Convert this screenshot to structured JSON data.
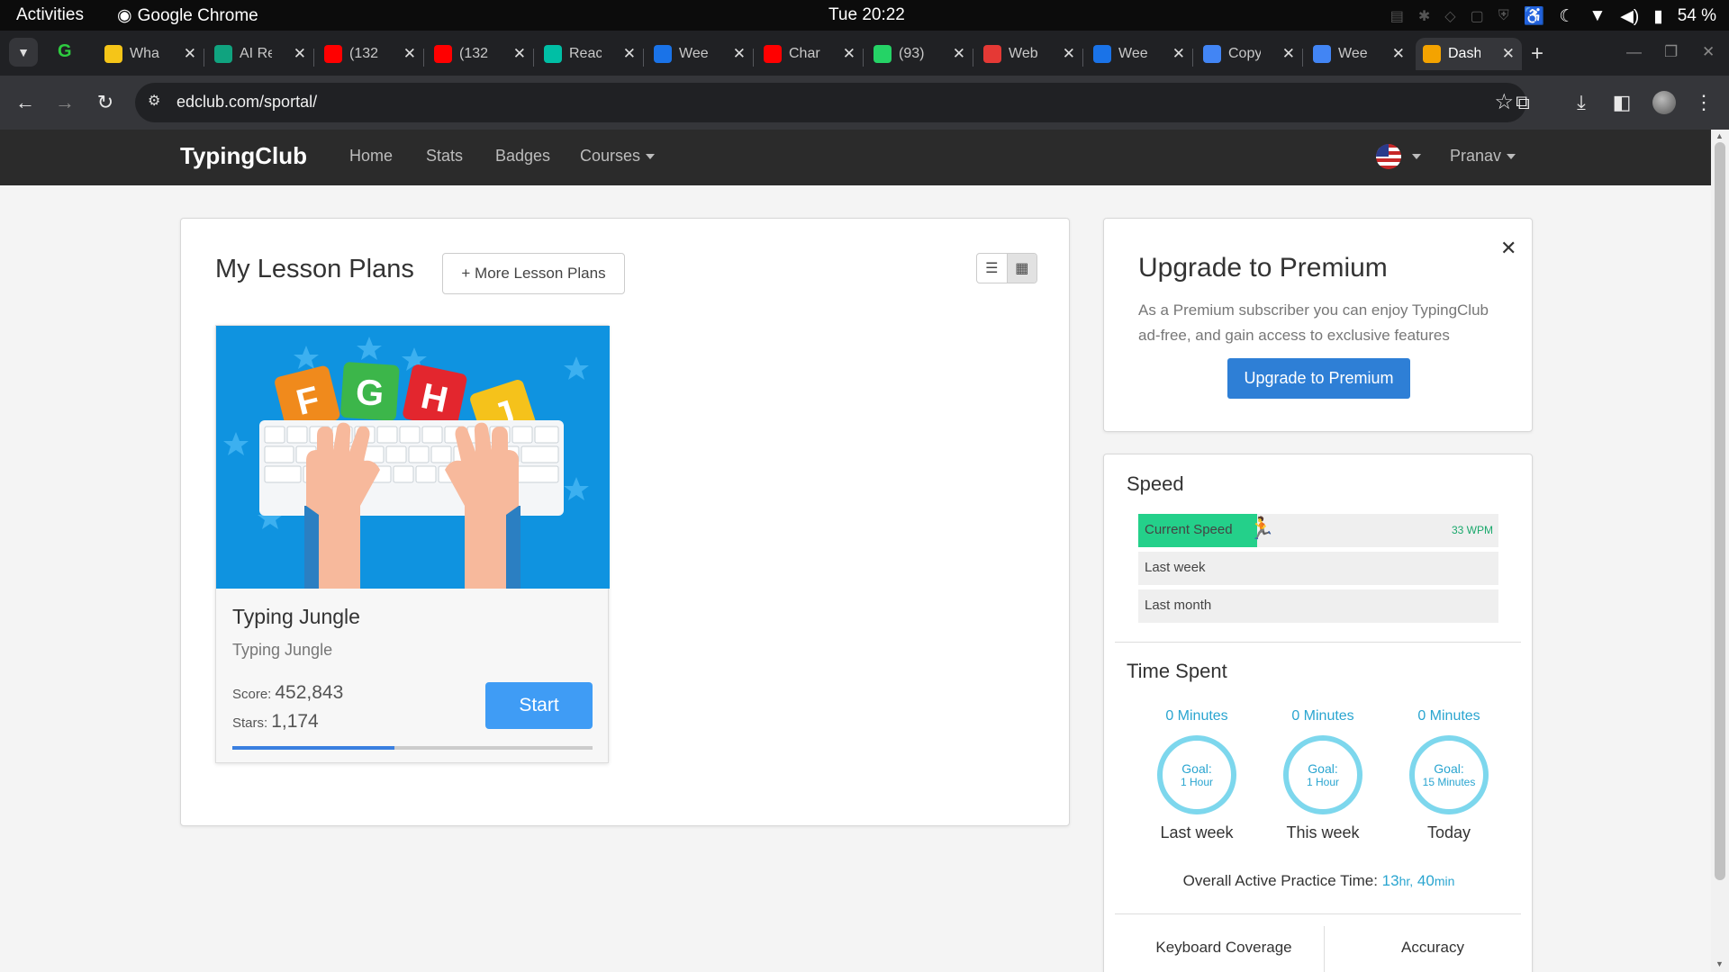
{
  "gnome": {
    "activities": "Activities",
    "app_name": "Google Chrome",
    "clock": "Tue 20:22",
    "battery": "54 %"
  },
  "tabs": [
    {
      "title": "Wha",
      "fav_color": "#f5c518"
    },
    {
      "title": "AI Re",
      "fav_color": "#10a37f"
    },
    {
      "title": "(132",
      "fav_color": "#ff0000"
    },
    {
      "title": "(132",
      "fav_color": "#ff0000"
    },
    {
      "title": "Reac",
      "fav_color": "#00bfa5"
    },
    {
      "title": "Wee",
      "fav_color": "#1a73e8"
    },
    {
      "title": "Char",
      "fav_color": "#ff0000"
    },
    {
      "title": "(93)",
      "fav_color": "#25d366"
    },
    {
      "title": "Web",
      "fav_color": "#e53935"
    },
    {
      "title": "Wee",
      "fav_color": "#1a73e8"
    },
    {
      "title": "Copy",
      "fav_color": "#4285f4"
    },
    {
      "title": "Wee",
      "fav_color": "#4285f4"
    },
    {
      "title": "Dash",
      "fav_color": "#f4a300"
    }
  ],
  "omnibox": {
    "url": "edclub.com/sportal/"
  },
  "site_nav": {
    "brand": "TypingClub",
    "links": [
      "Home",
      "Stats",
      "Badges",
      "Courses"
    ],
    "user": "Pranav"
  },
  "lessons": {
    "heading": "My Lesson Plans",
    "more_button": "+ More Lesson Plans",
    "plan": {
      "title": "Typing Jungle",
      "subtitle": "Typing Jungle",
      "score_label": "Score:",
      "score": "452,843",
      "stars_label": "Stars:",
      "stars": "1,174",
      "start_button": "Start",
      "progress": 0.45,
      "image_letters": [
        "F",
        "G",
        "H",
        "J"
      ]
    }
  },
  "premium": {
    "title": "Upgrade to Premium",
    "description": "As a Premium subscriber you can enjoy TypingClub ad-free, and gain access to exclusive features",
    "button": "Upgrade to Premium"
  },
  "speed": {
    "heading": "Speed",
    "rows": [
      {
        "label": "Current Speed",
        "value": "33 WPM",
        "fill": 0.33
      },
      {
        "label": "Last week",
        "value": "",
        "fill": 0
      },
      {
        "label": "Last month",
        "value": "",
        "fill": 0
      }
    ]
  },
  "time_spent": {
    "heading": "Time Spent",
    "periods": [
      {
        "minutes": "0 Minutes",
        "goal_label": "Goal:",
        "goal": "1 Hour",
        "period": "Last week"
      },
      {
        "minutes": "0 Minutes",
        "goal_label": "Goal:",
        "goal": "1 Hour",
        "period": "This week"
      },
      {
        "minutes": "0 Minutes",
        "goal_label": "Goal:",
        "goal": "15 Minutes",
        "period": "Today"
      }
    ],
    "overall_label": "Overall Active Practice Time:",
    "overall_hours": "13",
    "overall_hours_unit": "hr,",
    "overall_minutes": "40",
    "overall_minutes_unit": "min"
  },
  "bottom_tabs": [
    "Keyboard Coverage",
    "Accuracy"
  ],
  "colors": {
    "accent_blue": "#3f9cf5",
    "premium_blue": "#2e7fd6",
    "speed_green": "#24d08a",
    "time_teal": "#2aa5d0"
  }
}
